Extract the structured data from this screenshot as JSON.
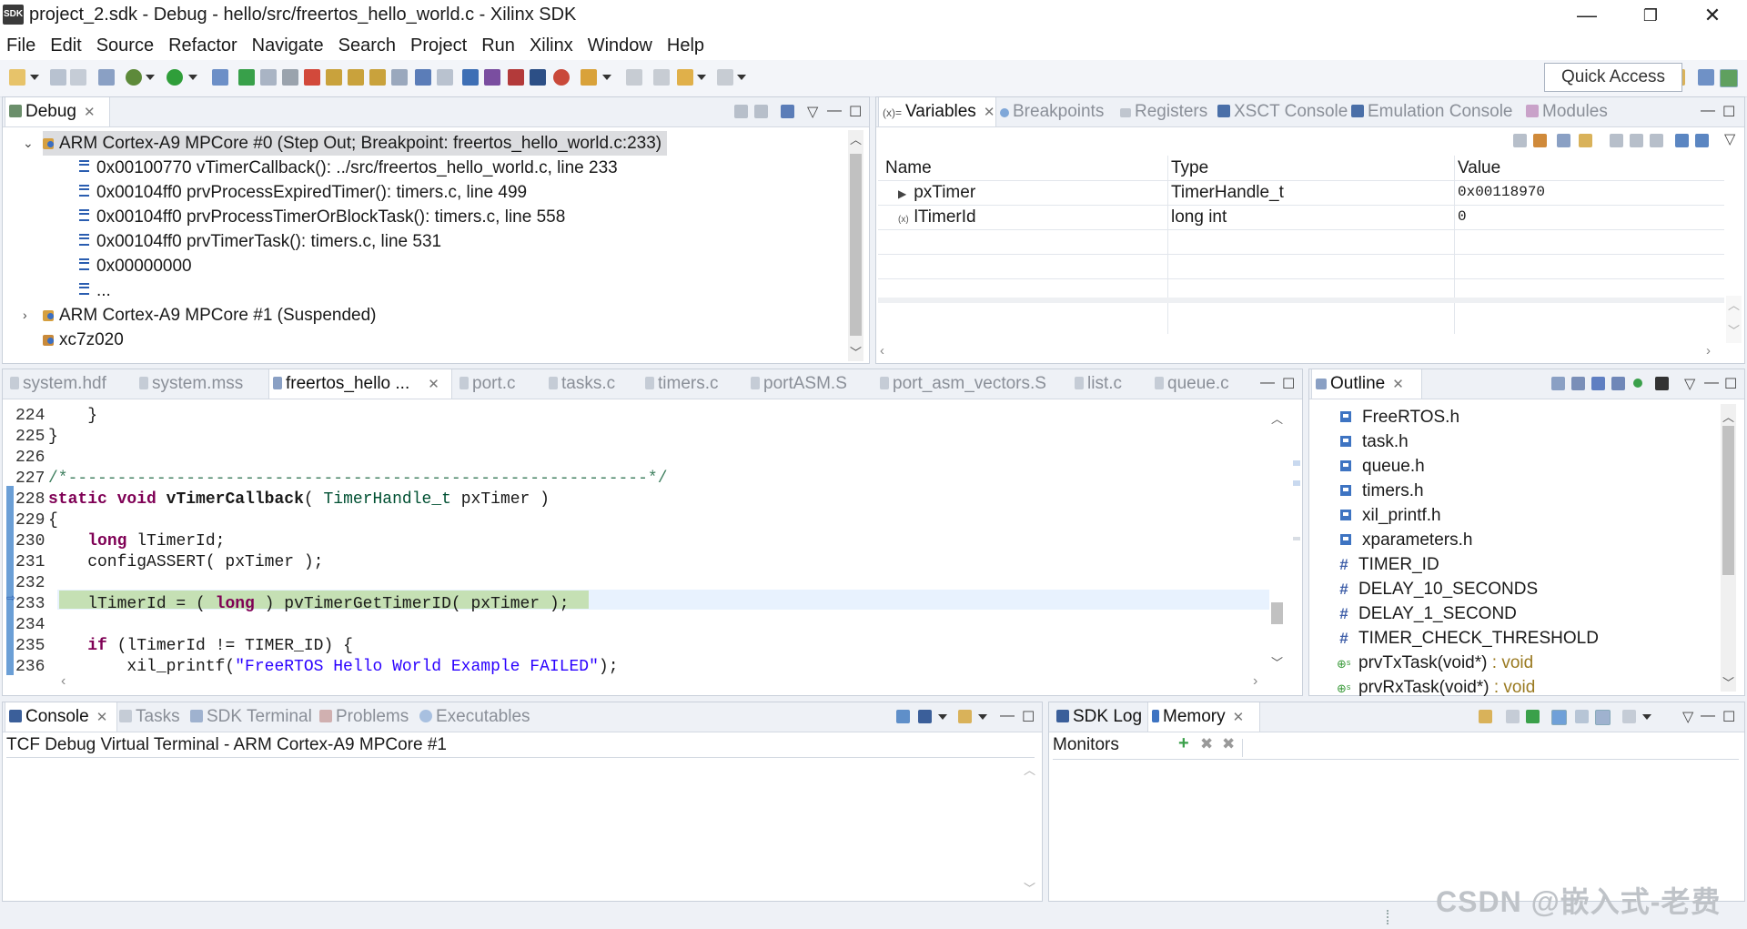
{
  "window": {
    "title": "project_2.sdk - Debug - hello/src/freertos_hello_world.c - Xilinx SDK",
    "app_icon_text": "SDK",
    "controls": {
      "minimize": "—",
      "restore": "❐",
      "close": "✕"
    }
  },
  "menu": [
    "File",
    "Edit",
    "Source",
    "Refactor",
    "Navigate",
    "Search",
    "Project",
    "Run",
    "Xilinx",
    "Window",
    "Help"
  ],
  "toolbar": {
    "quick_access": "Quick Access"
  },
  "debug_view": {
    "tab": "Debug",
    "tree": [
      {
        "text": "ARM Cortex-A9 MPCore #0 (Step Out; Breakpoint: freertos_hello_world.c:233)",
        "kind": "thread",
        "expanded": true,
        "selected": true
      },
      {
        "text": "0x00100770 vTimerCallback(): ../src/freertos_hello_world.c, line 233",
        "kind": "frame"
      },
      {
        "text": "0x00104ff0 prvProcessExpiredTimer(): timers.c, line 499",
        "kind": "frame"
      },
      {
        "text": "0x00104ff0 prvProcessTimerOrBlockTask(): timers.c, line 558",
        "kind": "frame"
      },
      {
        "text": "0x00104ff0 prvTimerTask(): timers.c, line 531",
        "kind": "frame"
      },
      {
        "text": "0x00000000",
        "kind": "frame"
      },
      {
        "text": "...",
        "kind": "frame"
      },
      {
        "text": "ARM Cortex-A9 MPCore #1 (Suspended)",
        "kind": "thread",
        "expanded": false
      },
      {
        "text": "xc7z020",
        "kind": "target"
      }
    ]
  },
  "variables_view": {
    "tabs": [
      "Variables",
      "Breakpoints",
      "Registers",
      "XSCT Console",
      "Emulation Console",
      "Modules"
    ],
    "columns": [
      "Name",
      "Type",
      "Value"
    ],
    "rows": [
      {
        "name": "pxTimer",
        "type": "TimerHandle_t",
        "value": "0x00118970",
        "expandable": true
      },
      {
        "name": "lTimerId",
        "type": "long int",
        "value": "0",
        "expandable": false
      }
    ]
  },
  "editor": {
    "tabs": [
      "system.hdf",
      "system.mss",
      "freertos_hello ...",
      "port.c",
      "tasks.c",
      "timers.c",
      "portASM.S",
      "port_asm_vectors.S",
      "list.c",
      "queue.c"
    ],
    "active_tab": 2,
    "lines": [
      {
        "n": "224",
        "code": "    }"
      },
      {
        "n": "225",
        "code": "}"
      },
      {
        "n": "226",
        "code": ""
      },
      {
        "n": "227",
        "code": "/*-----------------------------------------------------------*/"
      },
      {
        "n": "228",
        "code": "static void vTimerCallback( TimerHandle_t pxTimer )"
      },
      {
        "n": "229",
        "code": "{"
      },
      {
        "n": "230",
        "code": "    long lTimerId;"
      },
      {
        "n": "231",
        "code": "    configASSERT( pxTimer );"
      },
      {
        "n": "232",
        "code": ""
      },
      {
        "n": "233",
        "code": "    lTimerId = ( long ) pvTimerGetTimerID( pxTimer );"
      },
      {
        "n": "234",
        "code": ""
      },
      {
        "n": "235",
        "code": "    if (lTimerId != TIMER_ID) {"
      },
      {
        "n": "236",
        "code": "        xil_printf(\"FreeRTOS Hello World Example FAILED\");"
      }
    ],
    "current_line": "233"
  },
  "outline_view": {
    "tab": "Outline",
    "items": [
      {
        "kind": "include",
        "text": "FreeRTOS.h"
      },
      {
        "kind": "include",
        "text": "task.h"
      },
      {
        "kind": "include",
        "text": "queue.h"
      },
      {
        "kind": "include",
        "text": "timers.h"
      },
      {
        "kind": "include",
        "text": "xil_printf.h"
      },
      {
        "kind": "include",
        "text": "xparameters.h"
      },
      {
        "kind": "define",
        "text": "TIMER_ID"
      },
      {
        "kind": "define",
        "text": "DELAY_10_SECONDS"
      },
      {
        "kind": "define",
        "text": "DELAY_1_SECOND"
      },
      {
        "kind": "define",
        "text": "TIMER_CHECK_THRESHOLD"
      },
      {
        "kind": "function",
        "text": "prvTxTask(void*)",
        "ret": " : void"
      },
      {
        "kind": "function",
        "text": "prvRxTask(void*)",
        "ret": " : void"
      }
    ]
  },
  "console_view": {
    "tabs": [
      "Console",
      "Tasks",
      "SDK Terminal",
      "Problems",
      "Executables"
    ],
    "header": "TCF Debug Virtual Terminal - ARM Cortex-A9 MPCore #1"
  },
  "memory_view": {
    "tabs": [
      "SDK Log",
      "Memory"
    ],
    "monitors_label": "Monitors"
  },
  "watermark": "CSDN @嵌入式-老费"
}
